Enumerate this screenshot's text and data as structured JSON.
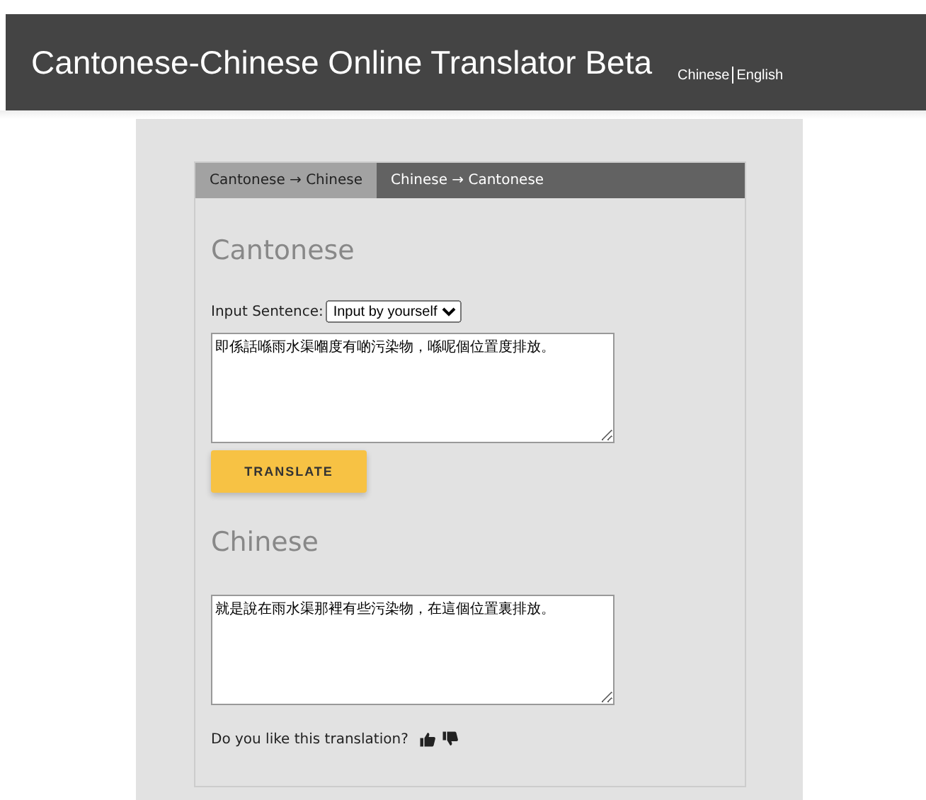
{
  "header": {
    "title": "Cantonese-Chinese Online Translator Beta",
    "languages": [
      "Chinese",
      "English"
    ]
  },
  "tabs": [
    {
      "label": "Cantonese → Chinese",
      "selected": true
    },
    {
      "label": "Chinese → Cantonese",
      "selected": false
    }
  ],
  "source": {
    "heading": "Cantonese",
    "input_label": "Input Sentence:",
    "input_mode": "Input by yourself",
    "text": "即係話喺雨水渠嗰度有啲污染物，喺呢個位置度排放。"
  },
  "translate_button": "TRANSLATE",
  "result": {
    "heading": "Chinese",
    "text": "就是說在雨水渠那裡有些污染物，在這個位置裏排放。"
  },
  "feedback": {
    "question": "Do you like this translation?"
  }
}
